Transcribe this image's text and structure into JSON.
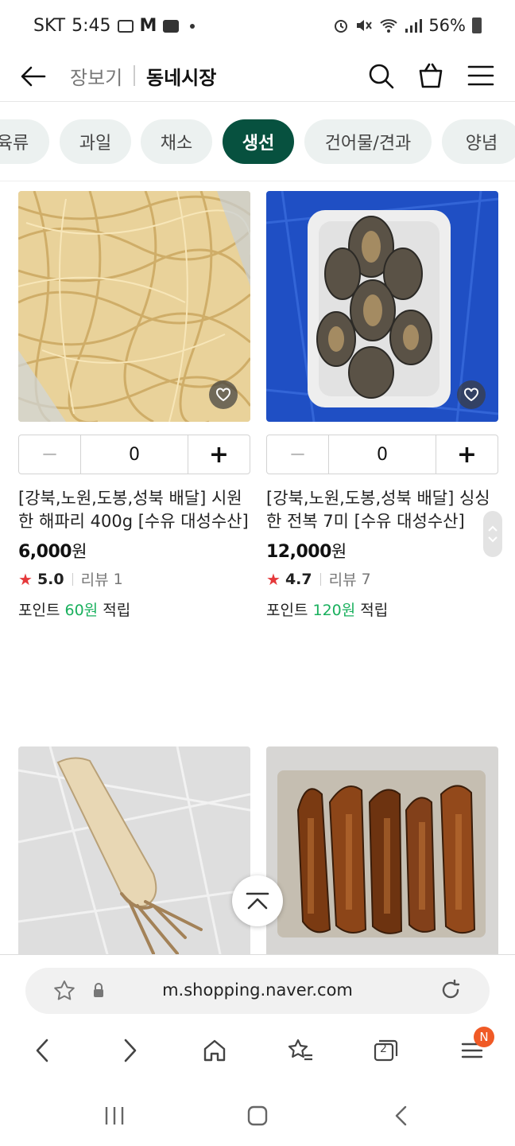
{
  "status_bar": {
    "carrier": "SKT",
    "time": "5:45",
    "battery": "56%"
  },
  "header": {
    "breadcrumb_parent": "장보기",
    "breadcrumb_current": "동네시장"
  },
  "tabs": [
    {
      "label": "육류",
      "active": false
    },
    {
      "label": "과일",
      "active": false
    },
    {
      "label": "채소",
      "active": false
    },
    {
      "label": "생선",
      "active": true
    },
    {
      "label": "건어물/견과",
      "active": false
    },
    {
      "label": "양념",
      "active": false
    }
  ],
  "products": [
    {
      "quantity": "0",
      "minus": "−",
      "plus": "+",
      "title": "[강북,노원,도봉,성북 배달] 시원한 해파리 400g [수유 대성수산]",
      "price": "6,000",
      "currency": "원",
      "rating": "5.0",
      "review_label": "리뷰",
      "review_count": "1",
      "points_prefix": "포인트",
      "points_amount": "60원",
      "points_suffix": "적립"
    },
    {
      "quantity": "0",
      "minus": "−",
      "plus": "+",
      "title": "[강북,노원,도봉,성북 배달] 싱싱한 전복 7미 [수유 대성수산]",
      "price": "12,000",
      "currency": "원",
      "rating": "4.7",
      "review_label": "리뷰",
      "review_count": "7",
      "points_prefix": "포인트",
      "points_amount": "120원",
      "points_suffix": "적립"
    }
  ],
  "browser": {
    "url": "m.shopping.naver.com",
    "tabs_count": "2",
    "menu_badge": "N"
  },
  "colors": {
    "accent": "#07513f",
    "points": "#19b05d",
    "star": "#e5383a",
    "badge": "#f05a26"
  }
}
